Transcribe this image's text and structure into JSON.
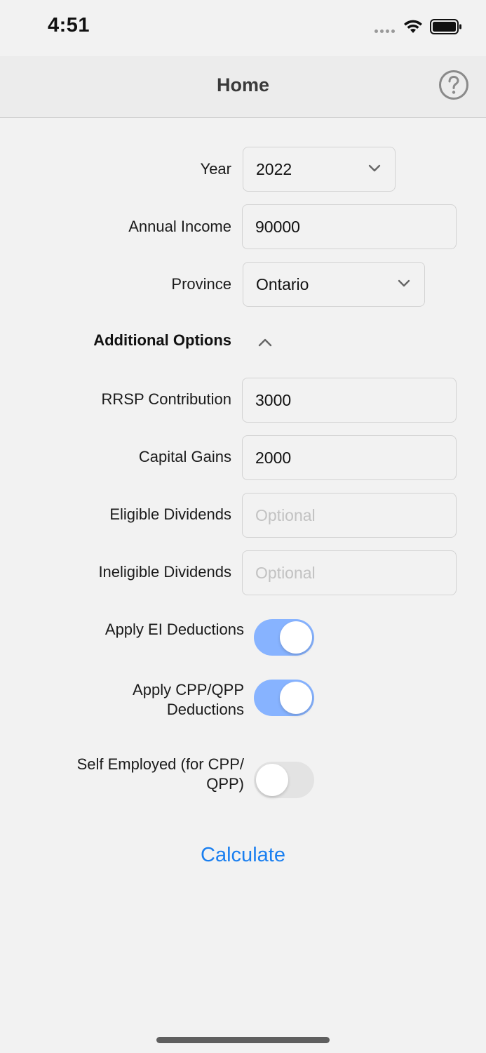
{
  "status": {
    "time": "4:51"
  },
  "nav": {
    "title": "Home",
    "help_icon": "question-circle-icon"
  },
  "form": {
    "year": {
      "label": "Year",
      "value": "2022"
    },
    "income": {
      "label": "Annual Income",
      "value": "90000"
    },
    "province": {
      "label": "Province",
      "value": "Ontario"
    }
  },
  "additional": {
    "title": "Additional Options",
    "expanded": true,
    "rrsp": {
      "label": "RRSP Contribution",
      "value": "3000"
    },
    "capital_gains": {
      "label": "Capital Gains",
      "value": "2000"
    },
    "eligible": {
      "label": "Eligible Dividends",
      "placeholder": "Optional"
    },
    "ineligible": {
      "label": "Ineligible Dividends",
      "placeholder": "Optional"
    },
    "ei": {
      "label": "Apply EI Deductions",
      "on": true
    },
    "cpp": {
      "label_line1": "Apply CPP/QPP",
      "label_line2": "Deductions",
      "on": true
    },
    "self_employed": {
      "label_line1": "Self Employed (for CPP/",
      "label_line2": "QPP)",
      "on": false
    }
  },
  "calculate_label": "Calculate",
  "colors": {
    "accent": "#1a7ff0",
    "toggle_on": "#87b3ff",
    "toggle_off": "#e3e3e3"
  }
}
